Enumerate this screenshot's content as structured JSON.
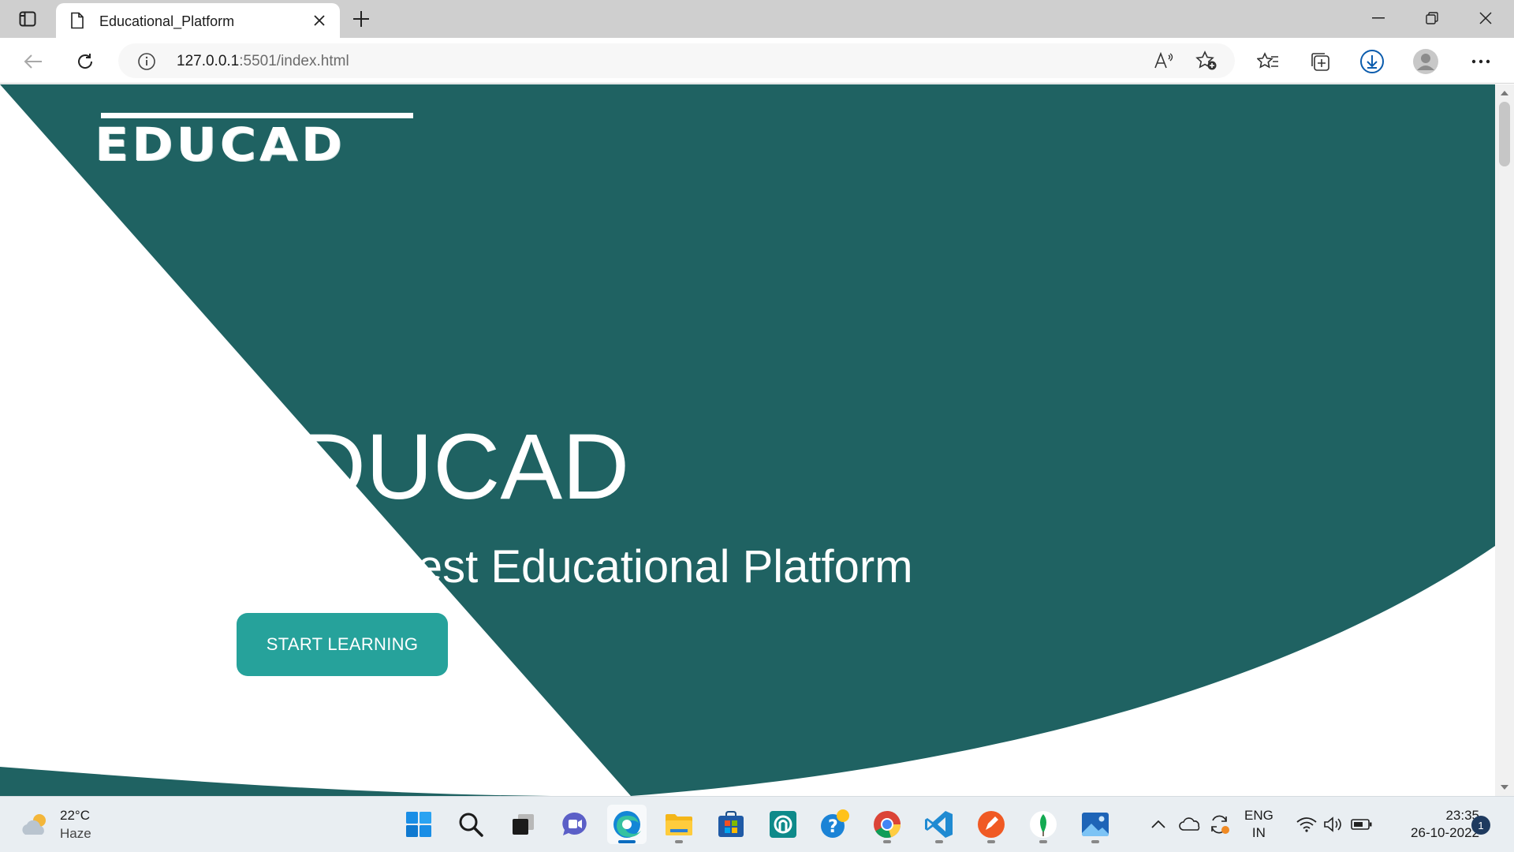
{
  "browser": {
    "tab": {
      "title": "Educational_Platform"
    },
    "address_bar": {
      "url_host": "127.0.0.1",
      "url_rest": ":5501/index.html"
    }
  },
  "page": {
    "logo_text": "EDUCAD",
    "hero": {
      "title": "EDUCAD",
      "subtitle": "India`s Best Educational Platform",
      "cta_label": "START LEARNING"
    },
    "colors": {
      "hero_bg": "#1f6262",
      "cta": "#26a29b",
      "text": "#ffffff"
    }
  },
  "taskbar": {
    "weather": {
      "temp": "22°C",
      "condition": "Haze"
    },
    "apps": [
      "start",
      "search",
      "task-view",
      "teams-chat",
      "edge",
      "file-explorer",
      "microsoft-store",
      "app-8",
      "tips",
      "chrome",
      "vscode",
      "app-12",
      "mongodb-compass",
      "photos"
    ],
    "language": {
      "line1": "ENG",
      "line2": "IN"
    },
    "clock": {
      "time": "23:35",
      "date": "26-10-2022"
    },
    "notification_count": "1"
  }
}
